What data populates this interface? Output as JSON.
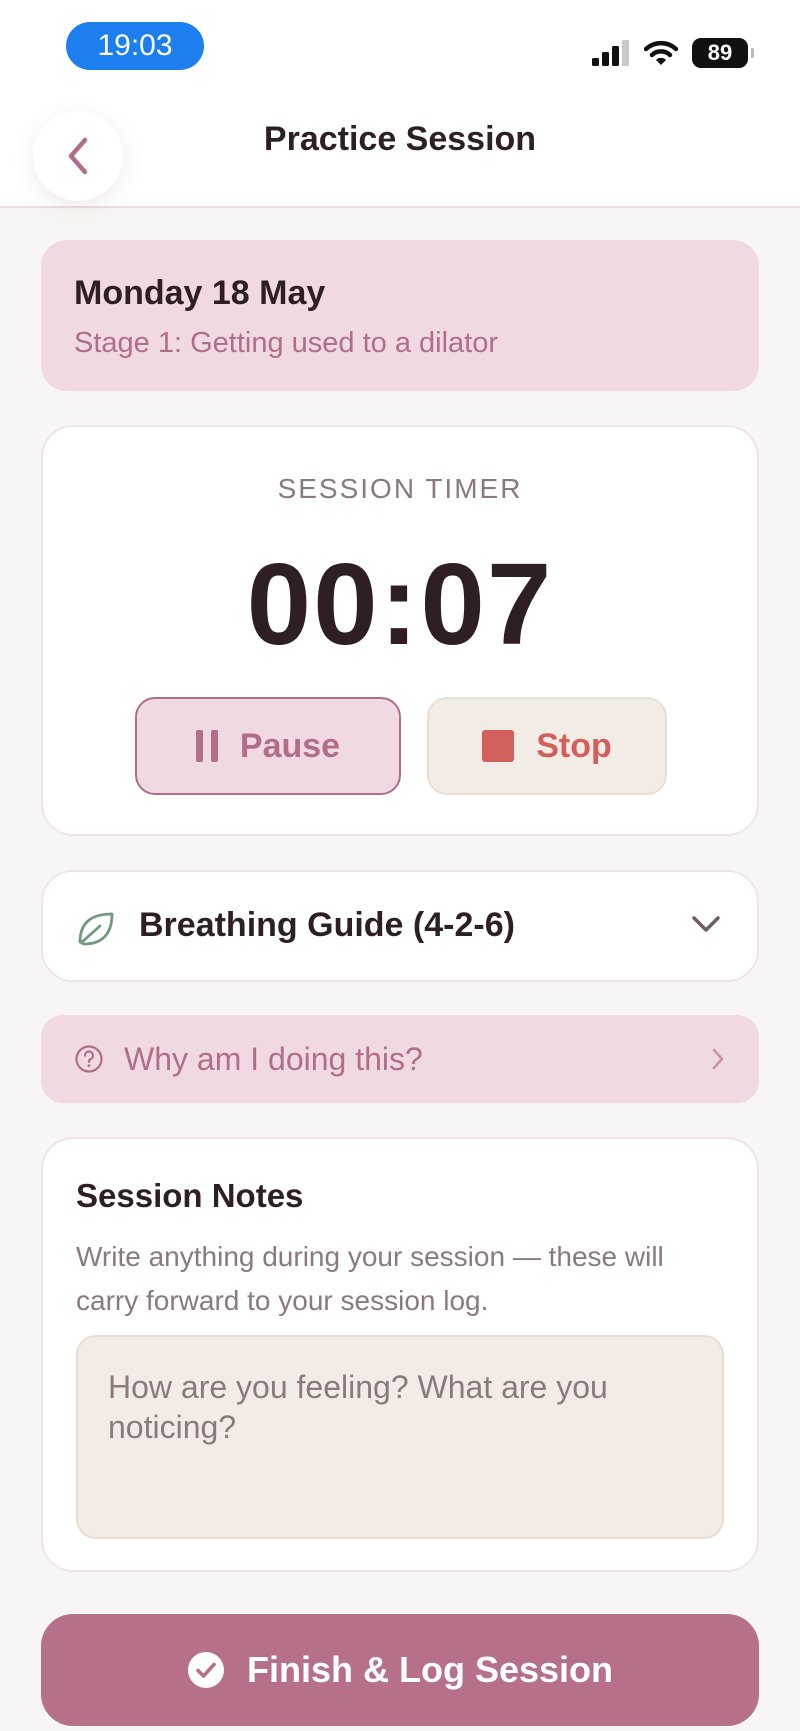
{
  "status_bar": {
    "time": "19:03",
    "battery": "89"
  },
  "header": {
    "title": "Practice Session"
  },
  "date_card": {
    "title": "Monday 18 May",
    "subtitle": "Stage 1: Getting used to a dilator"
  },
  "timer": {
    "label": "SESSION TIMER",
    "value": "00:07",
    "pause_label": "Pause",
    "stop_label": "Stop"
  },
  "breathing": {
    "title": "Breathing Guide (4-2-6)"
  },
  "why": {
    "label": "Why am I doing this?"
  },
  "notes": {
    "title": "Session Notes",
    "description": "Write anything during your session — these will carry forward to your session log.",
    "placeholder": "How are you feeling? What are you noticing?"
  },
  "finish": {
    "label": "Finish & Log Session"
  },
  "colors": {
    "accent": "#b6708a",
    "accent_light": "#f1d9e3",
    "stop_red": "#d35f5a",
    "leaf_green": "#6f9a7c",
    "status_blue": "#1d7ef0"
  }
}
